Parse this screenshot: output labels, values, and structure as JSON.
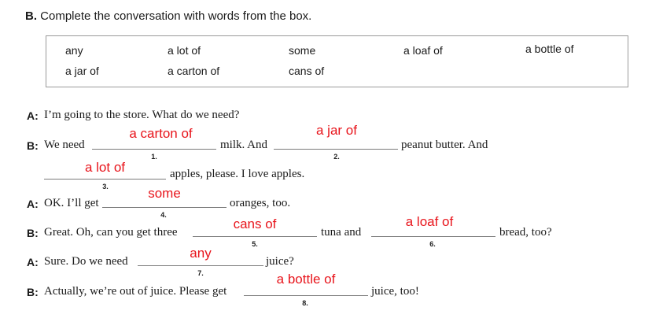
{
  "exercise": {
    "letter": "B.",
    "instruction": "Complete the conversation with words from the box."
  },
  "word_box": [
    "any",
    "a lot of",
    "some",
    "a loaf of",
    "a bottle of",
    "a jar of",
    "a carton of",
    "cans of"
  ],
  "dialogue": {
    "l1_speaker": "A:",
    "l1_text": "I’m going to the store. What do we need?",
    "l2_speaker": "B:",
    "l2_a": "We need",
    "l2_b": "milk. And",
    "l2_c": "peanut butter. And",
    "l3_a": "apples, please. I love apples.",
    "l4_speaker": "A:",
    "l4_a": "OK. I’ll get",
    "l4_b": "oranges, too.",
    "l5_speaker": "B:",
    "l5_a": "Great. Oh, can you get three",
    "l5_b": "tuna and",
    "l5_c": "bread, too?",
    "l6_speaker": "A:",
    "l6_a": "Sure. Do we need",
    "l6_b": "juice?",
    "l7_speaker": "B:",
    "l7_a": "Actually, we’re out of juice. Please get",
    "l7_b": "juice, too!"
  },
  "blank_numbers": [
    "1.",
    "2.",
    "3.",
    "4.",
    "5.",
    "6.",
    "7.",
    "8."
  ],
  "answers": [
    "a carton of",
    "a jar of",
    "a lot of",
    "some",
    "cans of",
    "a loaf of",
    "any",
    "a bottle of"
  ],
  "colors": {
    "answer": "#e8141b",
    "box_border": "#9a9a9a"
  }
}
